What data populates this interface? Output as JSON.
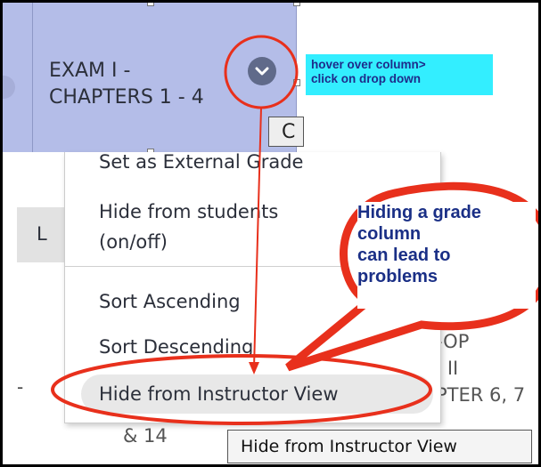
{
  "column_header": {
    "title": "EXAM I - CHAPTERS 1 - 4",
    "dropdown_icon": "chevron-down-icon"
  },
  "callout_note": {
    "line1": "hover over column>",
    "line2": "click on drop down"
  },
  "partial_button_letter": "C",
  "menu": {
    "items": [
      "Set as External Grade",
      "Hide from students",
      "(on/off)",
      "Sort Ascending",
      "Sort Descending",
      "Hide from Instructor View"
    ]
  },
  "background": {
    "tab_letter": "L",
    "dash": "-",
    "amp": "& 14",
    "right_line1": "-OP",
    "right_line2": "I II",
    "right_line3": "PTER 6, 7"
  },
  "tooltip": "Hide from Instructor View",
  "warning": {
    "line1": "Hiding a grade",
    "line2": "column",
    "line3": "can lead to",
    "line4": "problems"
  },
  "colors": {
    "header_bg": "#b4bde8",
    "annotation_red": "#e8301c",
    "note_bg": "#33eeff",
    "warning_text": "#1a2f86"
  }
}
